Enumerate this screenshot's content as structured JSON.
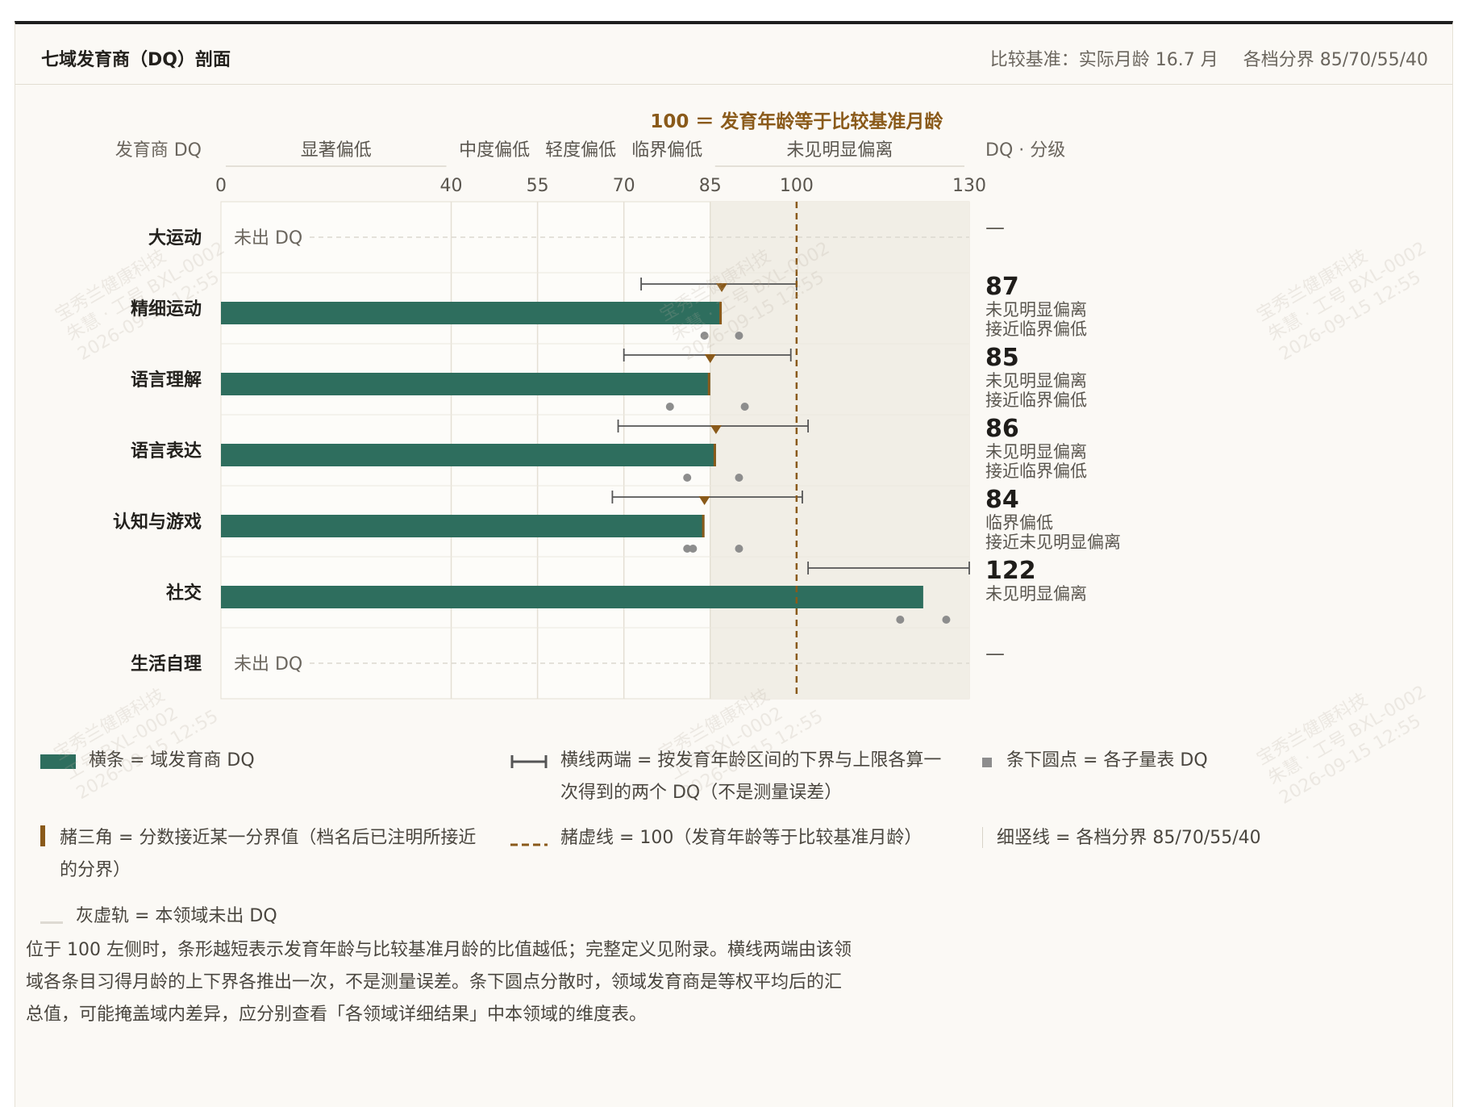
{
  "header": {
    "title": "七域发育商（DQ）剖面",
    "baseline": "比较基准：实际月龄 16.7 月",
    "thresholds": "各档分界 85/70/55/40"
  },
  "chart_data": {
    "type": "bar",
    "orientation": "horizontal",
    "title": "",
    "row_header": "发育商 DQ",
    "right_header": "DQ · 分级",
    "reference_label": "100 ＝ 发育年龄等于比较基准月龄",
    "reference_value": 100,
    "xlim": [
      0,
      130
    ],
    "x_ticks": [
      0,
      40,
      55,
      70,
      85,
      100,
      130
    ],
    "bands": [
      {
        "label": "显著偏低",
        "from": 0,
        "to": 40
      },
      {
        "label": "中度偏低",
        "from": 40,
        "to": 55
      },
      {
        "label": "轻度偏低",
        "from": 55,
        "to": 70
      },
      {
        "label": "临界偏低",
        "from": 70,
        "to": 85
      },
      {
        "label": "未见明显偏离",
        "from": 85,
        "to": 130
      }
    ],
    "no_dq_text": "未出 DQ",
    "domains": [
      {
        "name": "大运动",
        "dq": null,
        "dq_text": "—",
        "levels": []
      },
      {
        "name": "精细运动",
        "dq": 87,
        "dq_text": "87",
        "range": [
          73,
          100
        ],
        "near_cut": 87,
        "subscale_dots": [
          84,
          90
        ],
        "levels": [
          "未见明显偏离",
          "接近临界偏低"
        ]
      },
      {
        "name": "语言理解",
        "dq": 85,
        "dq_text": "85",
        "range": [
          70,
          99
        ],
        "near_cut": 85,
        "subscale_dots": [
          78,
          91
        ],
        "levels": [
          "未见明显偏离",
          "接近临界偏低"
        ]
      },
      {
        "name": "语言表达",
        "dq": 86,
        "dq_text": "86",
        "range": [
          69,
          102
        ],
        "near_cut": 86,
        "subscale_dots": [
          81,
          90
        ],
        "levels": [
          "未见明显偏离",
          "接近临界偏低"
        ]
      },
      {
        "name": "认知与游戏",
        "dq": 84,
        "dq_text": "84",
        "range": [
          68,
          101
        ],
        "near_cut": 84,
        "subscale_dots": [
          81,
          82,
          90
        ],
        "levels": [
          "临界偏低",
          "接近未见明显偏离"
        ]
      },
      {
        "name": "社交",
        "dq": 122,
        "dq_text": "122",
        "range": [
          102,
          130
        ],
        "near_cut": null,
        "subscale_dots": [
          118,
          126
        ],
        "levels": [
          "未见明显偏离"
        ]
      },
      {
        "name": "生活自理",
        "dq": null,
        "dq_text": "—",
        "levels": []
      }
    ],
    "colors": {
      "bar": "#2e6e5e",
      "marker": "#8a5a1a",
      "reference": "#8a5a1a",
      "dot": "#8d8d8d",
      "whisker": "#555555",
      "normal_band": "#f1eee6",
      "reference_label": "#8a5a1a"
    },
    "grid": true
  },
  "legend": {
    "bar": "横条 = 域发育商 DQ",
    "whisker": "横线两端 = 按发育年龄区间的下界与上限各算一次得到的两个 DQ（不是测量误差）",
    "dots": "条下圆点 = 各子量表 DQ",
    "triangle": "赭三角 = 分数接近某一分界值（档名后已注明所接近的分界）",
    "refline": "赭虚线 = 100（发育年龄等于比较基准月龄）",
    "gridline": "细竖线 = 各档分界 85/70/55/40",
    "track": "灰虚轨 = 本领域未出 DQ"
  },
  "note": "位于 100 左侧时，条形越短表示发育年龄与比较基准月龄的比值越低；完整定义见附录。横线两端由该领域各条目习得月龄的上下界各推出一次，不是测量误差。条下圆点分散时，领域发育商是等权平均后的汇总值，可能掩盖域内差异，应分别查看「各领域详细结果」中本领域的维度表。",
  "watermark": {
    "org": "宝秀兰健康科技",
    "id": "工号 BXL-0002",
    "name_id": "朱慧 · 工号 BXL-0002",
    "time": "2026-09-15 12:55"
  }
}
